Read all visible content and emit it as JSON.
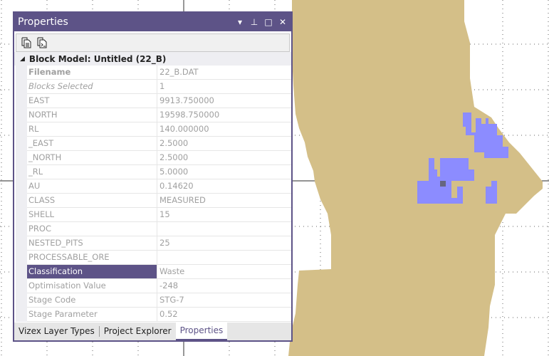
{
  "colors": {
    "accent": "#5d5387",
    "ore_body": "#d4bf88",
    "selection": "#8c8cff"
  },
  "panel": {
    "title": "Properties",
    "buttons": {
      "dropdown": "▾",
      "pin": "⊥",
      "maximize": "□",
      "close": "✕"
    },
    "toolbar": [
      "copy-icon",
      "copy-script-icon"
    ],
    "section_title": "Block Model: Untitled (22_B)",
    "rows": [
      {
        "key": "Filename",
        "value": "22_B.DAT",
        "style": "bold"
      },
      {
        "key": "Blocks Selected",
        "value": "1",
        "style": "ital"
      },
      {
        "key": "EAST",
        "value": "9913.750000"
      },
      {
        "key": "NORTH",
        "value": "19598.750000"
      },
      {
        "key": "RL",
        "value": "140.000000"
      },
      {
        "key": "_EAST",
        "value": "2.5000"
      },
      {
        "key": "_NORTH",
        "value": "2.5000"
      },
      {
        "key": "_RL",
        "value": "5.0000"
      },
      {
        "key": "AU",
        "value": "0.14620"
      },
      {
        "key": "CLASS",
        "value": "MEASURED"
      },
      {
        "key": "SHELL",
        "value": "15"
      },
      {
        "key": "PROC",
        "value": ""
      },
      {
        "key": "NESTED_PITS",
        "value": "25"
      },
      {
        "key": "PROCESSABLE_ORE",
        "value": ""
      },
      {
        "key": "Classification",
        "value": "Waste",
        "style": "sel"
      },
      {
        "key": "Optimisation Value",
        "value": "-248"
      },
      {
        "key": "Stage Code",
        "value": "STG-7"
      },
      {
        "key": "Stage Parameter",
        "value": "0.52"
      }
    ],
    "tabs": [
      {
        "label": "Vizex Layer Types"
      },
      {
        "label": "Project Explorer"
      },
      {
        "label": "Properties",
        "active": true
      }
    ]
  }
}
